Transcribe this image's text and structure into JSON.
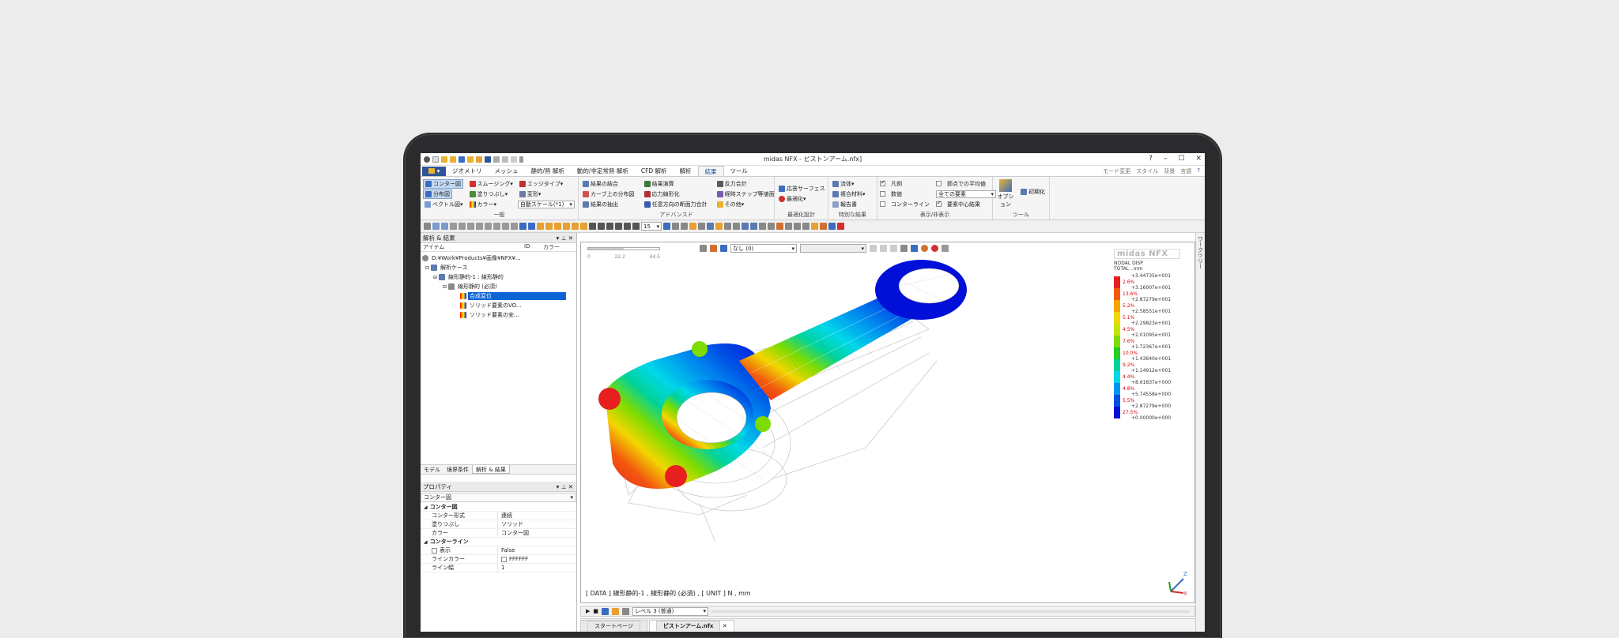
{
  "window": {
    "title": "midas NFX - ピストンアーム.nfx]"
  },
  "menu": {
    "file_label": "",
    "tabs": [
      "ジオメトリ",
      "メッシュ",
      "静的/熱 解析",
      "動的/非定常熱 解析",
      "CFD 解析",
      "解析",
      "結果",
      "ツール"
    ],
    "active_tab": 6,
    "right_items": [
      "モード変更",
      "スタイル",
      "背景",
      "言語"
    ]
  },
  "ribbon": {
    "general": {
      "label": "一般",
      "contour": "コンター図",
      "distribution": "分布図",
      "vector": "ベクトル図",
      "smoothing": "スムージング",
      "fill": "塗りつぶし",
      "color": "カラー",
      "edge_type": "エッジタイプ",
      "deform": "変形",
      "auto_scale": "自動スケール(*1)"
    },
    "advanced": {
      "label": "アドバンスド",
      "combine": "結果の結合",
      "curve_distribution": "カーブ上の分布図",
      "extract": "結果の抽出",
      "result_calc": "結果演算",
      "stress_linearize": "応力線形化",
      "arbitrary_section": "任意方向の断面力合計",
      "reaction_sum": "反力合計",
      "over_time": "経時ステップ等値面",
      "others": "その他"
    },
    "optimization": {
      "label": "最適化設計",
      "response_surface": "応答サーフェス",
      "optimize": "最適化"
    },
    "special": {
      "label": "特別な結果",
      "fluid": "流体",
      "composite": "複合材料",
      "report": "報告書"
    },
    "display": {
      "label": "表示/非表示",
      "legend": "凡例",
      "value": "数値",
      "contour_line": "コンターライン",
      "node_average": "節点での平均値",
      "all_elements": "全ての要素",
      "element_center": "要素中心結果"
    },
    "tools": {
      "label": "ツール",
      "option": "オプション",
      "initialize": "初期化"
    }
  },
  "toolbar": {
    "zoom_value": "15"
  },
  "left_panel": {
    "title": "解析 & 結果",
    "columns": [
      "アイテム",
      "ID",
      "カラー"
    ],
    "tree": [
      {
        "label": "D:¥Work¥Products¥画像¥NFX¥...",
        "level": 0
      },
      {
        "label": "解析ケース",
        "level": 1
      },
      {
        "label": "線形静的-1 : 線形静的",
        "level": 2
      },
      {
        "label": "線形静的 (必須)",
        "level": 3
      },
      {
        "label": "合成変位",
        "level": 4,
        "selected": true
      },
      {
        "label": "ソリッド要素のVO...",
        "level": 4
      },
      {
        "label": "ソリッド要素の安...",
        "level": 4
      }
    ],
    "tabs": [
      "モデル",
      "境界条件",
      "解析 & 結果"
    ],
    "active_tab": 2
  },
  "properties": {
    "title": "プロパティ",
    "selector": "コンター図",
    "rows": [
      {
        "type": "cat",
        "key": "コンター図"
      },
      {
        "key": "コンター形式",
        "value": "連続"
      },
      {
        "key": "塗りつぶし",
        "value": "ソリッド"
      },
      {
        "key": "カラー",
        "value": "コンター図"
      },
      {
        "type": "cat",
        "key": "コンターライン"
      },
      {
        "key": "表示",
        "value": "False"
      },
      {
        "key": "ラインカラー",
        "value": "FFFFFF"
      },
      {
        "key": "ライン幅",
        "value": "1"
      }
    ]
  },
  "viewport": {
    "select_value": "なし (0)",
    "scale_ticks": [
      "0",
      "22.2",
      "44.5"
    ],
    "status": "[ DATA ]  線形静的-1 , 線形静的 (必須) ,  [ UNIT ]    N , mm",
    "logo": "midas NFX",
    "legend_title": [
      "NODAL DISP",
      "TOTAL , mm"
    ],
    "legend_values": [
      "+3.44735e+001",
      "+3.16007e+001",
      "+2.87279e+001",
      "+2.58551e+001",
      "+2.29823e+001",
      "+2.01095e+001",
      "+1.72367e+001",
      "+1.43640e+001",
      "+1.14912e+001",
      "+8.61837e+000",
      "+5.74558e+000",
      "+2.87279e+000",
      "+0.00000e+000"
    ],
    "legend_pct": [
      "2.6%",
      "13.6%",
      "5.2%",
      "5.1%",
      "4.5%",
      "7.6%",
      "10.0%",
      "9.2%",
      "4.4%",
      "4.8%",
      "5.5%",
      "27.5%"
    ],
    "legend_colors": [
      "#e81f1f",
      "#f2590e",
      "#f7a400",
      "#f2d600",
      "#c7e400",
      "#7fdc00",
      "#22cf22",
      "#00d39b",
      "#00d8e8",
      "#0096f0",
      "#0050e6",
      "#0010d8"
    ]
  },
  "animation": {
    "level": "レベル 3 (普通)"
  },
  "doc_tabs": [
    "スタートページ",
    "ピストンアーム.nfx"
  ],
  "right_strip": "ワークツリー"
}
